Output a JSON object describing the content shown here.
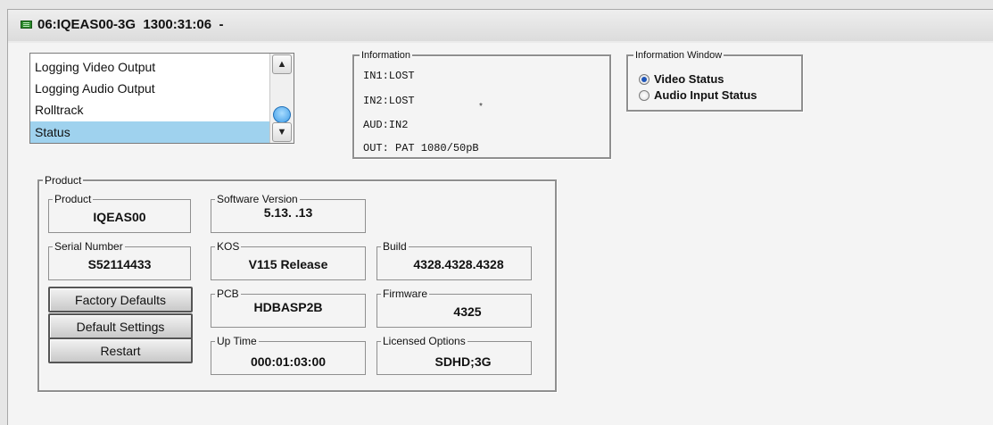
{
  "window": {
    "title": "06:IQEAS00-3G  1300:31:06  -"
  },
  "list": {
    "items": [
      "Logging Video Output",
      "Logging Audio Output",
      "Rolltrack",
      "Status"
    ],
    "selected_index": 3
  },
  "information": {
    "legend": "Information",
    "lines": [
      "IN1:LOST",
      "IN2:LOST",
      "AUD:IN2",
      "OUT: PAT 1080/50pB"
    ],
    "mark": "*"
  },
  "information_window": {
    "legend": "Information Window",
    "options": [
      {
        "label": "Video Status",
        "checked": true
      },
      {
        "label": "Audio Input Status",
        "checked": false
      }
    ]
  },
  "product": {
    "legend": "Product",
    "fields": {
      "product": {
        "label": "Product",
        "value": "IQEAS00"
      },
      "software_version": {
        "label": "Software Version",
        "value": "5.13. .13"
      },
      "serial_number": {
        "label": "Serial Number",
        "value": "S52114433"
      },
      "kos": {
        "label": "KOS",
        "value": "V115 Release"
      },
      "build": {
        "label": "Build",
        "value": "4328.4328.4328"
      },
      "pcb": {
        "label": "PCB",
        "value": "HDBASP2B"
      },
      "firmware": {
        "label": "Firmware",
        "value": "4325"
      },
      "up_time": {
        "label": "Up Time",
        "value": "000:01:03:00"
      },
      "licensed_options": {
        "label": "Licensed Options",
        "value": "SDHD;3G"
      }
    },
    "buttons": {
      "factory_defaults": "Factory Defaults",
      "default_settings": "Default Settings",
      "restart": "Restart"
    }
  },
  "icons": {
    "title": "device-icon",
    "scroll_up": "chevron-up-icon",
    "scroll_down": "chevron-down-icon"
  },
  "colors": {
    "selection": "#9fd2ee",
    "radio_checked": "#1f56b8",
    "device_icon": "#2d8a2d"
  }
}
